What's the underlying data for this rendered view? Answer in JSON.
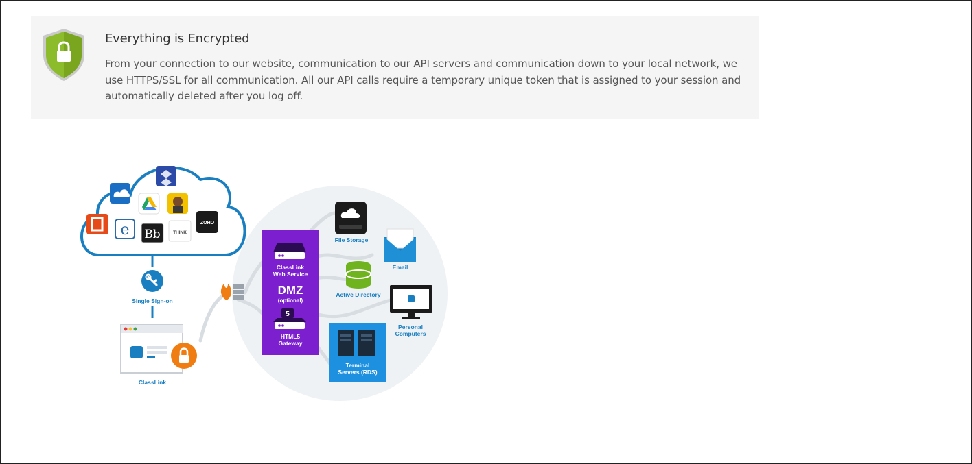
{
  "panel": {
    "title": "Everything is Encrypted",
    "description": "From your connection to our website, communication to our API servers and communication down to your local network, we use HTTPS/SSL for all communication. All our API calls require a temporary unique token that is assigned to your session and automatically deleted after you log off."
  },
  "diagram": {
    "sso_label": "Single Sign-on",
    "classlink_label": "ClassLink",
    "web_service_label": "ClassLink\nWeb Service",
    "dmz_label": "DMZ",
    "dmz_optional": "(optional)",
    "gateway_label": "HTML5\nGateway",
    "file_storage_label": "File Storage",
    "email_label": "Email",
    "active_directory_label": "Active Directory",
    "personal_computers_label": "Personal\nComputers",
    "terminal_servers_label": "Terminal\nServers (RDS)",
    "cloud_apps": {
      "blackboard": "Bb",
      "think": "THINK",
      "zoho": "ZOHO",
      "html5_badge": "5"
    }
  },
  "colors": {
    "panel_bg": "#f5f5f5",
    "shield_green": "#8cbc2c",
    "cloud_blue": "#1a7fc0",
    "dmz_purple": "#7b1fcf",
    "terminal_blue": "#1e90e0",
    "lock_orange": "#f07d12",
    "ad_green": "#6fb31f"
  }
}
